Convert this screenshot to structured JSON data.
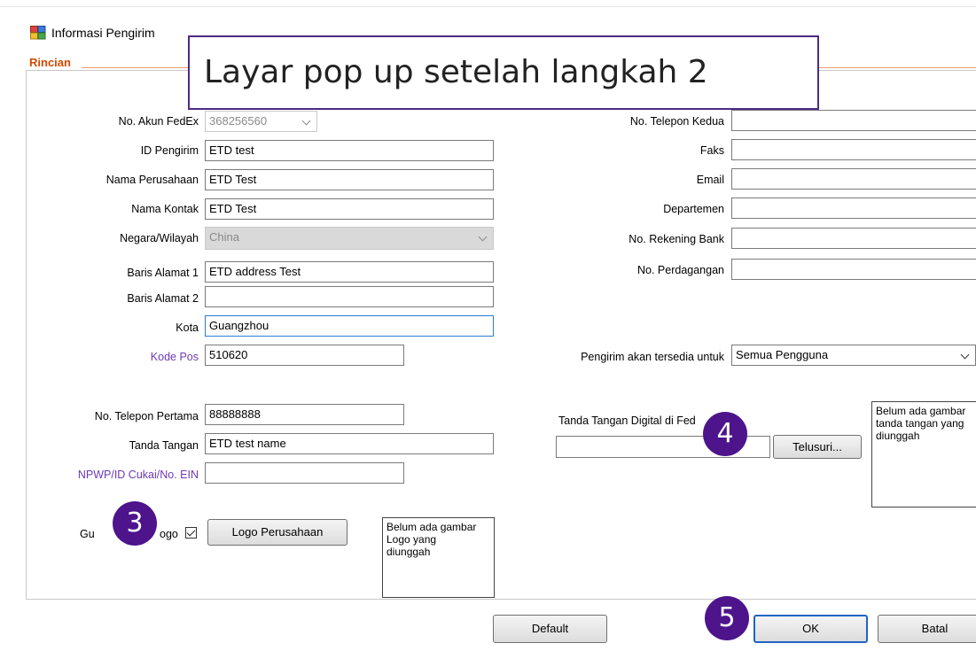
{
  "window": {
    "title": "Informasi Pengirim",
    "icon": "application-window-icon"
  },
  "group": {
    "label": "Rincian"
  },
  "annotation": {
    "callout": "Layar pop up setelah langkah 2",
    "steps": [
      "3",
      "4",
      "5"
    ]
  },
  "left_form": {
    "account": {
      "label": "No. Akun FedEx",
      "value": "368256560"
    },
    "sender_id": {
      "label": "ID Pengirim",
      "value": "ETD test"
    },
    "company": {
      "label": "Nama Perusahaan",
      "value": "ETD Test"
    },
    "contact": {
      "label": "Nama Kontak",
      "value": "ETD Test"
    },
    "country": {
      "label": "Negara/Wilayah",
      "value": "China"
    },
    "address1": {
      "label": "Baris Alamat 1",
      "value": "ETD address Test"
    },
    "address2": {
      "label": "Baris Alamat 2",
      "value": ""
    },
    "city": {
      "label": "Kota",
      "value": "Guangzhou"
    },
    "postal": {
      "label": "Kode Pos",
      "value": "510620"
    },
    "phone1": {
      "label": "No. Telepon Pertama",
      "value": "88888888"
    },
    "signature": {
      "label": "Tanda Tangan",
      "value": "ETD test name"
    },
    "tax_id": {
      "label": "NPWP/ID Cukai/No. EIN",
      "value": ""
    }
  },
  "right_form": {
    "phone2": {
      "label": "No. Telepon Kedua",
      "value": ""
    },
    "fax": {
      "label": "Faks",
      "value": ""
    },
    "email": {
      "label": "Email",
      "value": ""
    },
    "department": {
      "label": "Departemen",
      "value": ""
    },
    "bank_account": {
      "label": "No. Rekening Bank",
      "value": ""
    },
    "trade_no": {
      "label": "No. Perdagangan",
      "value": ""
    },
    "available_for": {
      "label": "Pengirim akan tersedia untuk",
      "value": "Semua Pengguna"
    }
  },
  "logo": {
    "label_left": "Gu",
    "label_right": "ogo",
    "checked": true,
    "button_label": "Logo Perusahaan",
    "placeholder": "Belum ada gambar\nLogo yang\ndiunggah"
  },
  "digital_signature": {
    "label": "Tanda Tangan Digital di Fed",
    "browse_label": "Telusuri...",
    "placeholder": "Belum ada gambar\ntanda tangan yang\ndiunggah"
  },
  "footer": {
    "default_label": "Default",
    "ok_label": "OK",
    "cancel_label": "Batal"
  },
  "colors": {
    "annotation_purple": "#4d148c",
    "group_orange": "#d14a00",
    "link_purple": "#6d3ab5",
    "focus_blue": "#2e7bd6"
  }
}
